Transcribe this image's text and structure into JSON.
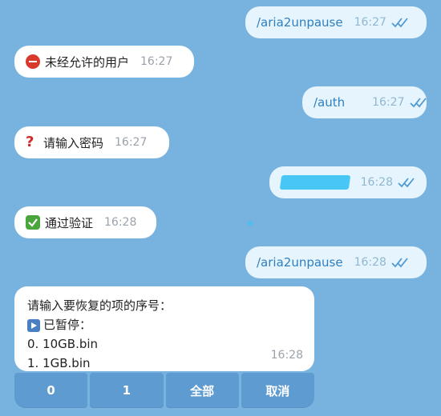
{
  "messages": [
    {
      "id": "m1",
      "side": "out",
      "text": "/aria2unpause",
      "time": "16:27",
      "read": true
    },
    {
      "id": "m2",
      "side": "in",
      "icon": "no-entry-icon",
      "text": "未经允许的用户",
      "time": "16:27"
    },
    {
      "id": "m3",
      "side": "out",
      "text": "/auth",
      "time": "16:27",
      "read": true
    },
    {
      "id": "m4",
      "side": "in",
      "icon": "question-mark-icon",
      "text": "请输入密码",
      "time": "16:27"
    },
    {
      "id": "m5",
      "side": "out",
      "text": "",
      "redacted": true,
      "time": "16:28",
      "read": true
    },
    {
      "id": "m6",
      "side": "in",
      "icon": "check-mark-icon",
      "text": "通过验证",
      "time": "16:28"
    },
    {
      "id": "m7",
      "side": "out",
      "text": "/aria2unpause",
      "time": "16:28",
      "read": true
    }
  ],
  "prompt": {
    "line1": "请输入要恢复的项的序号：",
    "line2": "已暂停：",
    "items": [
      "0. 10GB.bin",
      "1. 1GB.bin"
    ],
    "time": "16:28"
  },
  "keyboard": {
    "buttons": [
      "0",
      "1",
      "全部",
      "取消"
    ]
  },
  "colors": {
    "background": "#78b2de",
    "outgoing_bubble": "#e6f5fd",
    "incoming_bubble": "#ffffff",
    "keyboard_button": "#5d9bd1"
  }
}
